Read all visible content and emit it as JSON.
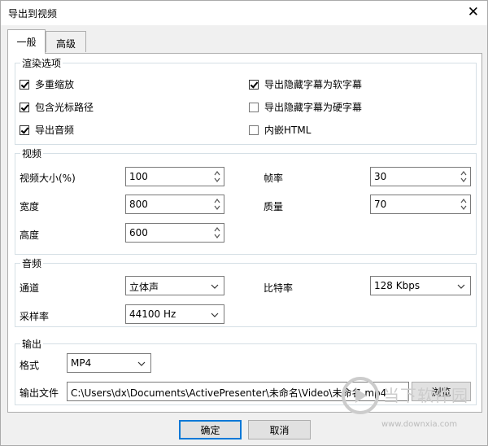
{
  "window": {
    "title": "导出到视频",
    "close_glyph": "✕"
  },
  "tabs": [
    {
      "label": "一般",
      "active": true
    },
    {
      "label": "高级",
      "active": false
    }
  ],
  "render": {
    "legend": "渲染选项",
    "options": [
      {
        "label": "多重缩放",
        "checked": true
      },
      {
        "label": "包含光标路径",
        "checked": true
      },
      {
        "label": "导出音频",
        "checked": true
      },
      {
        "label": "导出隐藏字幕为软字幕",
        "checked": true
      },
      {
        "label": "导出隐藏字幕为硬字幕",
        "checked": false
      },
      {
        "label": "内嵌HTML",
        "checked": false
      }
    ]
  },
  "video": {
    "legend": "视频",
    "size_label": "视频大小(%)",
    "size_value": "100",
    "width_label": "宽度",
    "width_value": "800",
    "height_label": "高度",
    "height_value": "600",
    "fps_label": "帧率",
    "fps_value": "30",
    "quality_label": "质量",
    "quality_value": "70"
  },
  "audio": {
    "legend": "音频",
    "channel_label": "通道",
    "channel_value": "立体声",
    "samplerate_label": "采样率",
    "samplerate_value": "44100 Hz",
    "bitrate_label": "比特率",
    "bitrate_value": "128 Kbps"
  },
  "output": {
    "legend": "输出",
    "format_label": "格式",
    "format_value": "MP4",
    "file_label": "输出文件",
    "file_value": "C:\\Users\\dx\\Documents\\ActivePresenter\\未命名\\Video\\未命名.mp4",
    "browse_label": "浏览"
  },
  "buttons": {
    "ok": "确定",
    "cancel": "取消"
  },
  "watermark": {
    "text": "当下软件园",
    "url": "www.downxia.com"
  },
  "colors": {
    "accent": "#0078d7",
    "border": "#adadad",
    "group_border": "#d5dfe5"
  }
}
